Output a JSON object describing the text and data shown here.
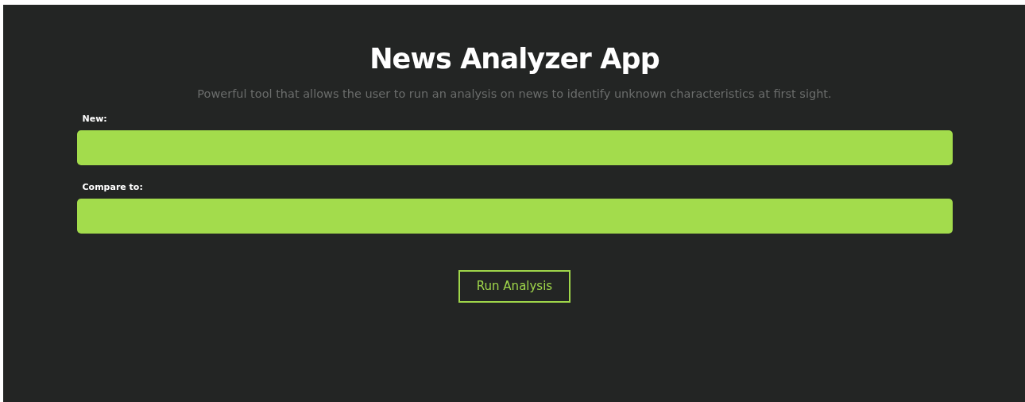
{
  "title": "News Analyzer App",
  "subtitle": "Powerful tool that allows the user to run an analysis on news to identify unknown characteristics at first sight.",
  "fields": [
    {
      "label": "New:"
    },
    {
      "label": "Compare to:"
    }
  ],
  "button": "Run Analysis"
}
